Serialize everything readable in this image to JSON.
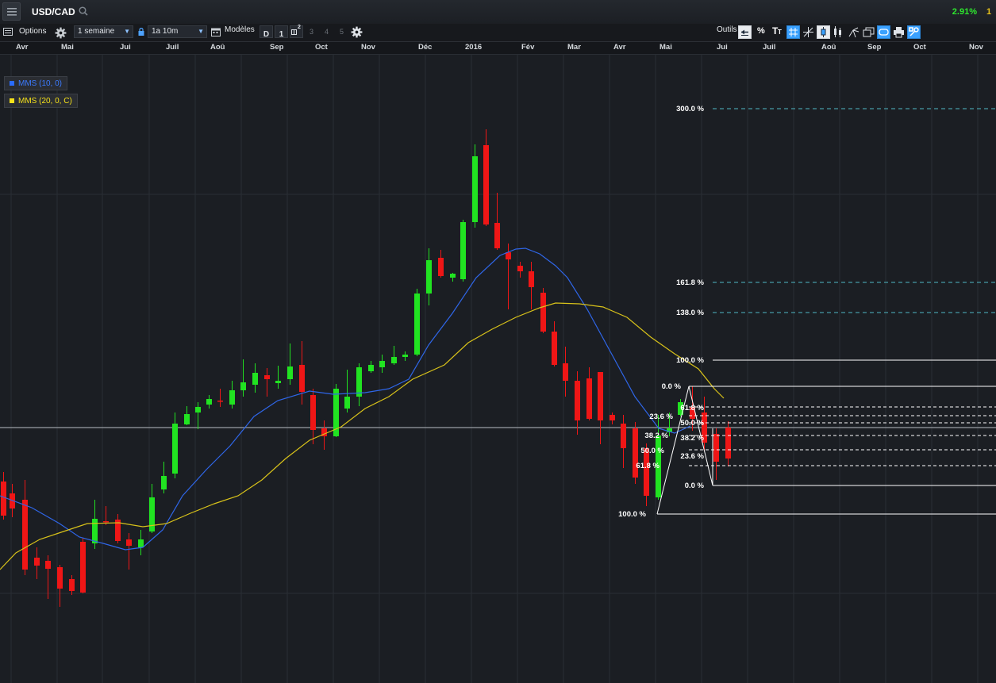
{
  "header": {
    "symbol": "USD/CAD",
    "change_pct": "2.91%",
    "change_extra": "1"
  },
  "toolbar": {
    "options_label": "Options",
    "interval": "1 semaine",
    "range": "1a 10m",
    "models_label": "Modèles",
    "d_label": "D",
    "n1": "1",
    "n2": "2",
    "n3": "3",
    "n4": "4",
    "n5": "5",
    "tools_label": "Outils",
    "percent_label": "%"
  },
  "time_axis": [
    "Avr",
    "Mai",
    "Jui",
    "Juil",
    "Aoû",
    "Sep",
    "Oct",
    "Nov",
    "Déc",
    "2016",
    "Fév",
    "Mar",
    "Avr",
    "Mai",
    "Jui",
    "Juil",
    "Aoû",
    "Sep",
    "Oct",
    "Nov"
  ],
  "legend": [
    {
      "label": "MMS (10, 0)",
      "color": "#2a6cff"
    },
    {
      "label": "MMS (20, 0, C)",
      "color": "#f5e11a"
    }
  ],
  "colors": {
    "bull": "#21e321",
    "bear": "#ef1616",
    "ma10": "#2f66e8",
    "ma20": "#d8c21a",
    "fib_ext": "#4fb8c4"
  },
  "fib_extension": [
    "300.0 %",
    "161.8 %",
    "138.0 %",
    "100.0 %"
  ],
  "fib_main": [
    "0.0 %",
    "23.6 %",
    "38.2 %",
    "50.0 %",
    "61.8 %",
    "100.0 %"
  ],
  "fib_right": [
    "61.8 %",
    "50.0 %",
    "38.2 %",
    "23.6 %",
    "0.0 %"
  ]
}
